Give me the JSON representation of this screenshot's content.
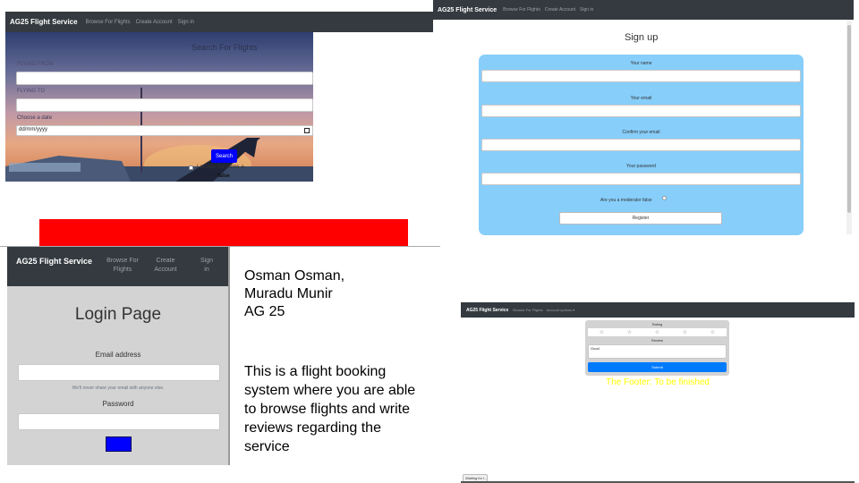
{
  "search_panel": {
    "nav": {
      "brand": "AG25 Flight Service",
      "links": [
        "Browse For Flights",
        "Create Account",
        "Sign in"
      ]
    },
    "title": "Search For Flights",
    "flying_from_label": "FLYING FROM",
    "flying_to_label": "FLYING TO",
    "date_label": "Choose a date",
    "date_placeholder": "dd/mm/yyyy",
    "search_button": "Search",
    "terms_label": "I accept the terms a",
    "terms_value": "false"
  },
  "signup_panel": {
    "nav": {
      "brand": "AG25 Flight Service",
      "links": [
        "Browse For Flights",
        "Create Account",
        "Sign in"
      ]
    },
    "title": "Sign up",
    "fields": [
      "Your name",
      "Your email",
      "Confirm your email",
      "Your password"
    ],
    "moderator_label": "Are you a moderator false",
    "register_button": "Register"
  },
  "login_panel": {
    "nav": {
      "brand": "AG25 Flight Service",
      "link1": [
        "Browse For",
        "Flights"
      ],
      "link2": [
        "Create",
        "Account"
      ],
      "link3": [
        "Sign",
        "in"
      ]
    },
    "title": "Login Page",
    "email_label": "Email address",
    "email_help": "We'll never share your email with anyone else.",
    "password_label": "Password"
  },
  "authors": {
    "line1": "Osman Osman,",
    "line2": "Muradu Munir",
    "line3": "AG 25"
  },
  "description": {
    "lines": [
      "This is a flight booking",
      "system where you are able",
      "to browse flights and write",
      "reviews regarding the",
      "service"
    ]
  },
  "review_panel": {
    "nav": {
      "brand": "AG25 Flight Service",
      "links": [
        "Browse For Flights",
        "Account options ▾"
      ]
    },
    "rating_label": "Rating",
    "review_label": "Review",
    "review_value": "Good",
    "submit_button": "Submit",
    "footer_text": "The Footer: To be finished",
    "taskbar_item": "Waiting for l..."
  },
  "colors": {
    "navbar": "#343a40",
    "signup_form": "#87cefa",
    "red_banner": "#ff0000",
    "primary_blue": "#0000ff",
    "submit_blue": "#007bff",
    "footer_yellow": "#ffff00",
    "login_bg": "#d3d3d3"
  }
}
